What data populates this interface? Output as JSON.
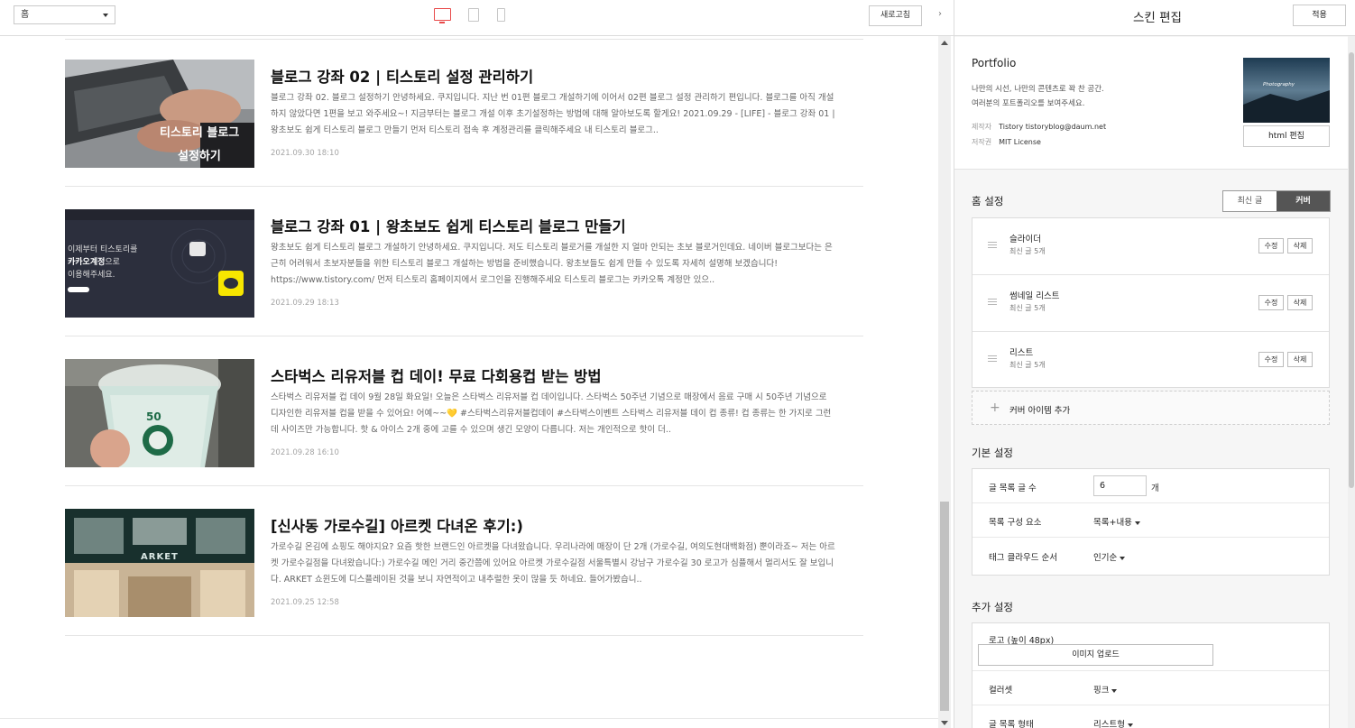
{
  "toolbar": {
    "page_select": "홈",
    "refresh_label": "새로고침",
    "toggle_label": "›"
  },
  "posts": [
    {
      "title": "블로그 강좌 02 | 티스토리 설정 관리하기",
      "excerpt": "블로그 강좌 02. 블로그 설정하기 안녕하세요. 쿠지입니다. 지난 번 01편 블로그 개설하기에 이어서 02편 블로그 설정 관리하기 편입니다. 블로그를 아직 개설하지 않았다면 1편을 보고 와주세요~! 지금부터는 블로그 개설 이후 초기설정하는 방법에 대해 알아보도록 할게요! 2021.09.29 - [LIFE] - 블로그 강좌 01 | 왕초보도 쉽게 티스토리 블로그 만들기 먼저 티스토리 접속 후 계정관리를 클릭해주세요 내 티스토리 블로그..",
      "date": "2021.09.30 18:10",
      "thumb_text_1": "티스토리 블로그",
      "thumb_text_2": "설정하기"
    },
    {
      "title": "블로그 강좌 01 | 왕초보도 쉽게 티스토리 블로그 만들기",
      "excerpt": "왕초보도 쉽게 티스토리 블로그 개설하기 안녕하세요. 쿠지입니다. 저도 티스토리 블로거를 개설한 지 얼마 안되는 초보 블로거인데요. 네이버 블로그보다는 은근히 어려워서 초보자분들을 위한 티스토리 블로그 개설하는 방법을 준비했습니다. 왕초보들도 쉽게 만들 수 있도록 자세히 설명해 보겠습니다! https://www.tistory.com/ 먼저 티스토리 홈페이지에서 로그인을 진행해주세요 티스토리 블로그는 카카오톡 계정만 있으..",
      "date": "2021.09.29 18:13",
      "thumb_text_1": "이제부터 티스토리를",
      "thumb_text_2": "카카오계정",
      "thumb_text_3": "으로",
      "thumb_text_4": "이용해주세요."
    },
    {
      "title": "스타벅스 리유저블 컵 데이! 무료 다회용컵 받는 방법",
      "excerpt": "스타벅스 리유저블 컵 데이 9월 28일 화요일! 오늘은 스타벅스 리유저블 컵 데이입니다. 스타벅스 50주년 기념으로 매장에서 음료 구매 시 50주년 기념으로 디자인한 리유저블 컵을 받을 수 있어요! 어예~~💛 #스타벅스리유저블컵데이 #스타벅스이벤트 스타벅스 리유저블 데이 컵 종류! 컵 종류는 한 가지로 그런데 사이즈만 가능합니다. 핫 & 아이스 2개 중에 고를 수 있으며 생긴 모양이 다릅니다. 저는 개인적으로 핫이 더..",
      "date": "2021.09.28 16:10",
      "thumb_text_1": "50"
    },
    {
      "title": "[신사동 가로수길] 아르켓 다녀온 후기:)",
      "excerpt": "가로수길 온김에 쇼핑도 해야지요? 요즘 핫한 브랜드인 아르켓을 다녀왔습니다. 우리나라에 매장이 단 2개 (가로수길, 여의도현대백화점) 뿐이라죠~ 저는 아르켓 가로수길점을 다녀왔습니다:) 가로수길 메인 거리 중간쯤에 있어요 아르켓 가로수길점 서울특별시 강남구 가로수길 30 로고가 심플해서 멀리서도 잘 보입니다. ARKET 쇼윈도에 디스플레이된 것을 보니 자연적이고 내추럴한 옷이 많을 듯 하네요. 들어가봤습니..",
      "date": "2021.09.25 12:58",
      "thumb_text_1": "ARKET"
    }
  ],
  "panel": {
    "title": "스킨 편집",
    "apply_label": "적용",
    "skin_name": "Portfolio",
    "skin_desc_1": "나만의 시선, 나만의 콘텐츠로 꽉 찬 공간.",
    "skin_desc_2": "여러분의 포트폴리오를 보여주세요.",
    "maker_label": "제작자",
    "maker_value": "Tistory tistoryblog@daum.net",
    "license_label": "저작권",
    "license_value": "MIT License",
    "thumb_text": "Photography",
    "html_edit_label": "html 편집",
    "home_settings_title": "홈 설정",
    "seg_latest": "최신 글",
    "seg_cover": "커버",
    "cover_items": [
      {
        "name": "슬라이더",
        "sub": "최신 글 5개"
      },
      {
        "name": "썸네일 리스트",
        "sub": "최신 글 5개"
      },
      {
        "name": "리스트",
        "sub": "최신 글 5개"
      }
    ],
    "edit_label": "수정",
    "delete_label": "삭제",
    "add_cover_plus": "+",
    "add_cover_label": "커버 아이템 추가",
    "basic_title": "기본 설정",
    "post_count_label": "글 목록 글 수",
    "post_count_value": "6",
    "post_count_unit": "개",
    "list_comp_label": "목록 구성 요소",
    "list_comp_value": "목록+내용",
    "tag_order_label": "태그 클라우드 순서",
    "tag_order_value": "인기순",
    "extra_title": "추가 설정",
    "logo_label": "로고 (높이 48px)",
    "upload_label": "이미지 업로드",
    "colorset_label": "컬러셋",
    "colorset_value": "핑크",
    "list_type_label": "글 목록 형태",
    "list_type_value": "리스트형"
  },
  "colors": {
    "accent": "#e84b4b",
    "kakao_yellow": "#f7e600",
    "dark_navy": "#2c2f3d"
  }
}
